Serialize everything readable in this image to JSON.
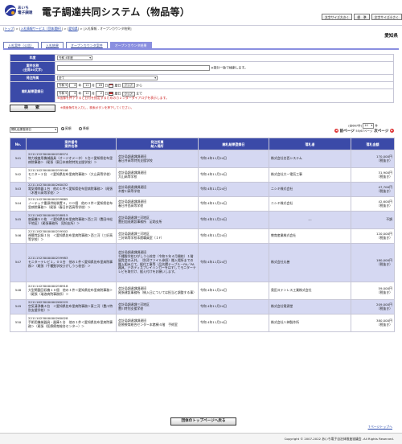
{
  "header": {
    "logo_line1": "あいち",
    "logo_line2": "電子調達",
    "system_title": "電子調達共同システム（物品等）",
    "font_buttons": [
      "文字サイズ大きく",
      "標　準",
      "文字サイズ小さく"
    ]
  },
  "breadcrumb": {
    "items": [
      "トップ",
      "入札情報サービス（団体選択）",
      "愛知県"
    ],
    "current": "入札情報 - オープンカウンタ結果"
  },
  "region": "愛知県",
  "tabs": [
    "入札案件（公告）",
    "入札結果",
    "オープンカウンタ案件",
    "オープンカウンタ結果"
  ],
  "active_tab": 3,
  "search": {
    "fiscal_year_label": "年度",
    "fiscal_year_value": "令和 4年度",
    "case_name_label": "案件名称",
    "case_name_sub": "(全角30文字)",
    "case_name_value": "",
    "case_name_note": "※部分一致で検索します。",
    "org_label": "発注所属",
    "org_value": "全て",
    "date_label": "開札結果登録日",
    "from": {
      "era": "令和",
      "year": "4",
      "month": "11",
      "day": "16",
      "suffix": "から"
    },
    "to": {
      "era": "令和",
      "year": "4",
      "month": "12",
      "day": "2",
      "suffix": "まで"
    },
    "unit_y": "年",
    "unit_m": "月",
    "unit_d": "日",
    "calendar_label": "暦日",
    "clear_label": "クリア",
    "date_note": "※画像を押下すると日付を指定するためのカレンダーダイアログを表示します。",
    "search_button": "検　索",
    "search_note": "※検索条件を入力し、検索ボタンを押下してください。"
  },
  "results": {
    "sort_value": "開札結果登録日",
    "asc_label": "昇順",
    "desc_label": "降順",
    "count_text": "(全667件)",
    "per_page": "10",
    "per_page_unit": "件",
    "prev": "前ページ",
    "next": "次ページ",
    "page_info": "55/67ページ",
    "headers": [
      "No.",
      "案件番号\n案件名称",
      "発注所属\n納入場所",
      "開札結果登録日",
      "落札者",
      "落札金額"
    ],
    "rows": [
      {
        "no": "541",
        "num": "22111523000000258974",
        "name": "物力検査用機械器具（オージオメータ）１台＜愛知県佐布里病院事務＞（尾張（東日本病院特別支援学校）＞",
        "org": "会計局調達課調達班",
        "place": "春日井高等特別支援学校",
        "date": "令和 4年11月24日",
        "winner": "株式会社名西システム",
        "amount": "170,000円",
        "tax": "（税抜き）"
      },
      {
        "no": "542",
        "num": "22111023000000259546",
        "name": "モニター２台　＜愛知県佐布里病院事務＞（大山高等学校）＞",
        "org": "会計局調達課調達班",
        "place": "大山高等学校",
        "date": "令和 4年11月24日",
        "winner": "株式会社大一電気工事",
        "amount": "31,900円",
        "tax": "（税抜き）"
      },
      {
        "no": "543",
        "num": "22111023000000260032",
        "name": "電気掃除器１台　他の１件＜愛知県佐布里病院事務＞（尾張（木曽川高等学校）＞",
        "org": "会計局調達課調達班",
        "place": "木曽川高等学校",
        "date": "令和 4年11月24日",
        "winner": "ニシキ株式会社",
        "amount": "47,700円",
        "tax": "（税抜き）"
      },
      {
        "no": "544",
        "num": "22111423000000259865",
        "name": "ノーテック重源供給装置４，００個　他の３件＜愛知県佐布里病院事務＞（尾張（春日井西高等学校）＞",
        "org": "会計局調達課調達班",
        "place": "春日井西高等学校",
        "date": "令和 4年11月24日",
        "winner": "ニシキ株式会社",
        "amount": "42,600円",
        "tax": "（税抜き）"
      },
      {
        "no": "545",
        "num": "22111623000000258815",
        "name": "扇風機５０枚　＜愛知県佐布里病院事務＞西三河（豊田市松平地区）（尾張事務所　見知支所）＞",
        "org": "会計局調達課三河地区",
        "place": "豊田加茂建設事務所　足助支所",
        "date": "令和 4年11月24日",
        "winner": "---",
        "amount": "不調",
        "tax": ""
      },
      {
        "no": "546",
        "num": "22111823000000259502",
        "name": "視聴覚記録１台　＜愛知県佐布里病院事務＞西三河（三好高等学校）＞",
        "org": "会計局調達課三河地区",
        "place": "三好高等学校本館職員室（１F）",
        "date": "令和 4年11月24日",
        "winner": "教育産業株式会社",
        "amount": "120,000円",
        "tax": "（税抜き）"
      },
      {
        "no": "547",
        "num": "22111523000000259983",
        "name": "モニターテレビ１，００台　他の１件＜愛知県佐布里病院事務＞（尾張（千種聾学校ひがしうら校舎）＞",
        "org": "会計局調達課調達班",
        "place": "千種聾学校ひがしうら校舎（令和５年４月開校）１階展覧会の天井。（別添ファイル参照）搬入場所までの搬入組み立て、据付工事等（品名欄テーブル－PA／PA器具、ドのディスプレイハンガーをはずしてモニターテレビを取付け、据え付けをお願いします。",
        "date": "令和 4年11月24日",
        "winner": "株式会社丸善",
        "amount": "180,000円",
        "tax": "（税抜き）"
      },
      {
        "no": "548",
        "num": "22111423000000258918",
        "name": "大型掲載回収機１０個　他の１件＜愛知県佐布里病院事務＞（尾張（瑞浪病院事務所）＞",
        "org": "会計局調達課調達班",
        "place": "尾張建設事務所（納入日については担当と調整する事）",
        "date": "令和 4年11月24日",
        "winner": "奥田ステンレス工業株式会社",
        "amount": "59,000円",
        "tax": "（税抜き）"
      },
      {
        "no": "549",
        "num": "22111623000000260229",
        "name": "空気清浄機４台　＜愛知県佐布里病院事務＞東三河（豊川特別支援学校）＞",
        "org": "会計局調達課三河地区",
        "place": "豊川特別支援学校",
        "date": "令和 4年11月24日",
        "winner": "株式会社電源堂",
        "amount": "209,000円",
        "tax": "（税抜き）"
      },
      {
        "no": "550",
        "num": "22111023000000260028",
        "name": "手術用機械器具・器庫１台　他の１件＜愛知県佐布里病院事務＞（尾張（医療療育総合センター）＞",
        "org": "会計局調達課調達班",
        "place": "医療療育総合センター本館棟４階　手術室",
        "date": "令和 4年11月24日",
        "winner": "株式会社八神製作所",
        "amount": "380,000円",
        "tax": "（税抜き）"
      }
    ]
  },
  "bottom": {
    "top_button": "団体のトップページへ戻る",
    "page_top": "↑ページトップへ"
  },
  "footer": "Copyright © 2007-2022 あいち電子自治体推進協議会. All Rights Reserved."
}
